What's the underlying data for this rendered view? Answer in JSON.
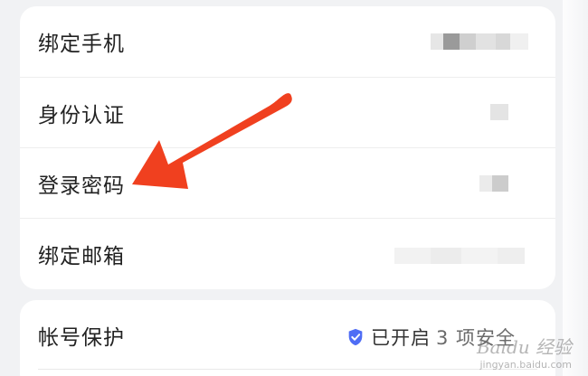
{
  "settings": {
    "rows": [
      {
        "label": "绑定手机"
      },
      {
        "label": "身份认证"
      },
      {
        "label": "登录密码"
      },
      {
        "label": "绑定邮箱"
      }
    ],
    "protection": {
      "label": "帐号保护",
      "status": "已开启",
      "status_suffix": "3 项安全"
    }
  },
  "icons": {
    "status": "shield-check-icon",
    "annotation": "red-arrow-pointer"
  },
  "colors": {
    "arrow": "#f0401f",
    "shield": "#4f6df5"
  },
  "watermark": {
    "logo": "Baidu 经验",
    "url": "jingyan.baidu.com"
  }
}
